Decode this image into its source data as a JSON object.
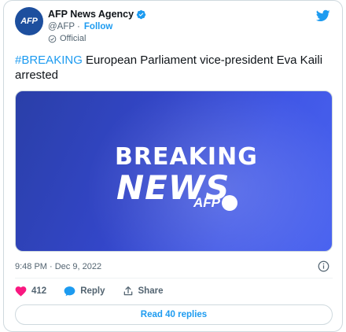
{
  "author": {
    "avatar_text": "AFP",
    "name": "AFP News Agency",
    "handle": "@AFP",
    "separator": "·",
    "follow_label": "Follow",
    "official_label": "Official"
  },
  "tweet": {
    "hashtag": "#BREAKING",
    "text": " European Parliament vice-president Eva Kaili arrested"
  },
  "media": {
    "line1": "BREAKING",
    "line2": "NEWS",
    "logo_text": "AFP"
  },
  "meta": {
    "timestamp": "9:48 PM · Dec 9, 2022"
  },
  "actions": {
    "like_count": "412",
    "reply_label": "Reply",
    "share_label": "Share"
  },
  "read_replies_label": "Read 40 replies",
  "colors": {
    "accent": "#1d9bf0",
    "like": "#f91880",
    "media_blue": "#3346c8"
  }
}
